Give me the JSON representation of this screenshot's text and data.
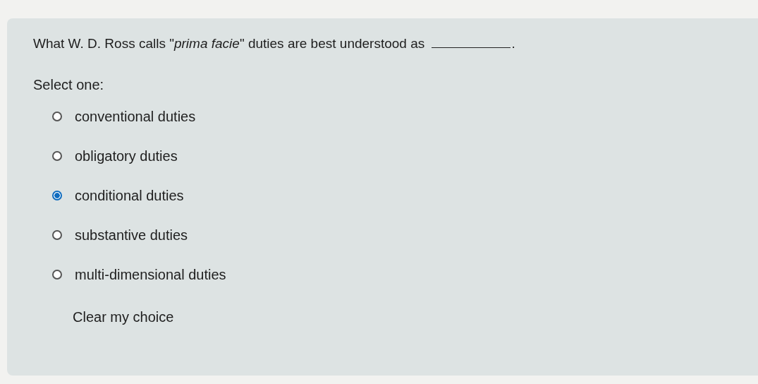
{
  "question": {
    "before": "What W. D. Ross calls \"*prima facie*\" duties are best understood as",
    "after": "."
  },
  "prompt": "Select one:",
  "options": [
    {
      "label": "conventional duties",
      "selected": false
    },
    {
      "label": "obligatory duties",
      "selected": false
    },
    {
      "label": "conditional duties",
      "selected": true
    },
    {
      "label": "substantive duties",
      "selected": false
    },
    {
      "label": "multi-dimensional duties",
      "selected": false
    }
  ],
  "clear_link": "Clear my choice"
}
